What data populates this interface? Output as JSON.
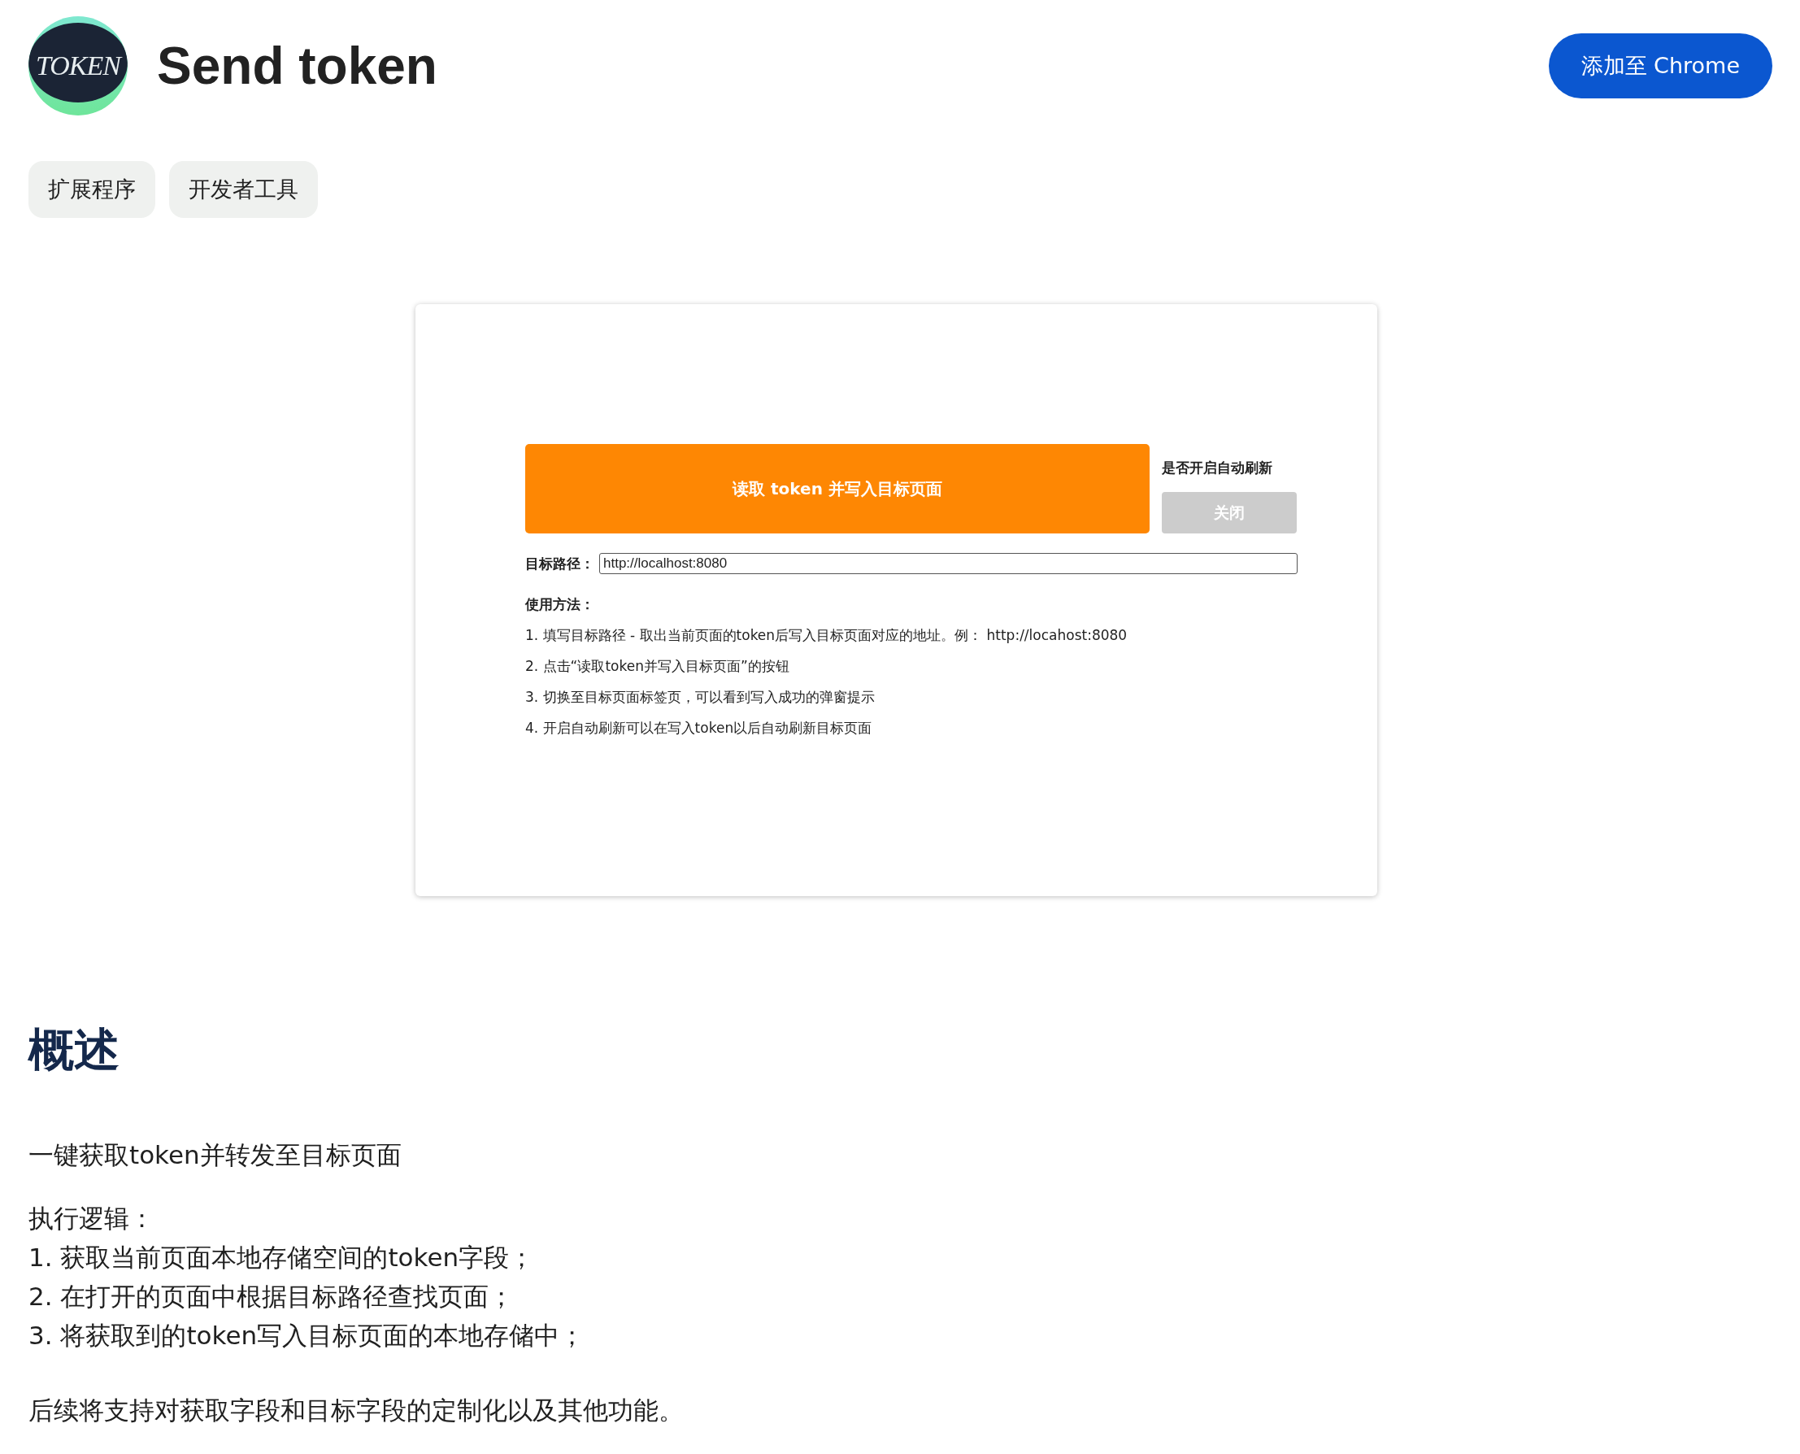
{
  "header": {
    "logo_text": "TOKEN",
    "title": "Send token",
    "add_button": "添加至 Chrome"
  },
  "categories": [
    {
      "label": "扩展程序"
    },
    {
      "label": "开发者工具"
    }
  ],
  "screenshot": {
    "main_button": "读取 token 并写入目标页面",
    "auto_refresh_label": "是否开启自动刷新",
    "auto_refresh_button": "关闭",
    "path_label": "目标路径：",
    "path_value": "http://localhost:8080",
    "usage_title": "使用方法：",
    "usage_steps": [
      "1. 填写目标路径 - 取出当前页面的token后写入目标页面对应的地址。例： http://locahost:8080",
      "2. 点击“读取token并写入目标页面”的按钮",
      "3. 切换至目标页面标签页，可以看到写入成功的弹窗提示",
      "4. 开启自动刷新可以在写入token以后自动刷新目标页面"
    ]
  },
  "overview": {
    "heading": "概述",
    "summary": "一键获取token并转发至目标页面",
    "logic_title": "执行逻辑：",
    "logic_steps": [
      "1. 获取当前页面本地存储空间的token字段；",
      "2. 在打开的页面中根据目标路径查找页面；",
      "3. 将获取到的token写入目标页面的本地存储中；"
    ],
    "footer_note": "后续将支持对获取字段和目标字段的定制化以及其他功能。"
  }
}
